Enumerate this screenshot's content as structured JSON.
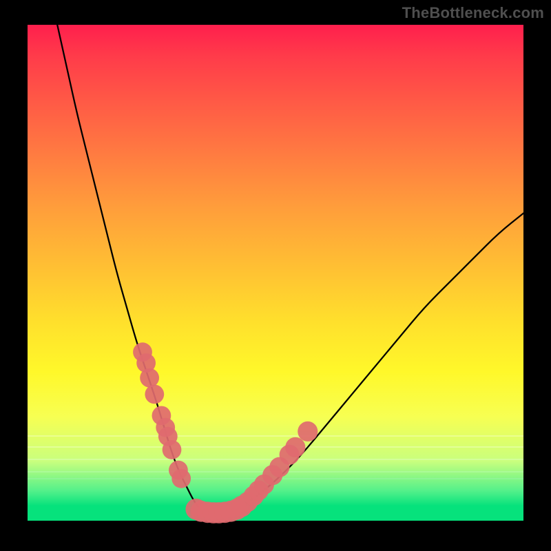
{
  "watermark": "TheBottleneck.com",
  "colors": {
    "frame_bg": "#000000",
    "curve_stroke": "#000000",
    "blob_fill": "#e06a6f",
    "blob_stroke": "#e06a6f"
  },
  "chart_data": {
    "type": "line",
    "title": "",
    "xlabel": "",
    "ylabel": "",
    "xlim": [
      0,
      100
    ],
    "ylim": [
      0,
      100
    ],
    "series": [
      {
        "name": "curve",
        "x": [
          6,
          8,
          10,
          12,
          14,
          16,
          18,
          20,
          22,
          24,
          26,
          27.5,
          29,
          30.5,
          32,
          33.5,
          35,
          41,
          45,
          50,
          55,
          60,
          65,
          70,
          75,
          80,
          85,
          90,
          95,
          100
        ],
        "values": [
          100,
          91,
          82,
          74,
          66,
          58,
          50,
          43,
          36,
          30,
          24,
          19,
          14,
          10,
          7,
          4,
          2,
          2,
          4,
          8,
          13,
          19,
          25,
          31,
          37,
          43,
          48,
          53,
          58,
          62
        ]
      }
    ],
    "markers": [
      {
        "x": 23.2,
        "y": 34.0,
        "r": 1.1
      },
      {
        "x": 23.9,
        "y": 31.8,
        "r": 1.1
      },
      {
        "x": 24.6,
        "y": 28.8,
        "r": 1.1
      },
      {
        "x": 25.6,
        "y": 25.5,
        "r": 1.1
      },
      {
        "x": 27.0,
        "y": 21.2,
        "r": 1.1
      },
      {
        "x": 27.8,
        "y": 18.8,
        "r": 1.1
      },
      {
        "x": 28.3,
        "y": 17.0,
        "r": 1.1
      },
      {
        "x": 29.1,
        "y": 14.3,
        "r": 1.1
      },
      {
        "x": 30.4,
        "y": 10.2,
        "r": 1.1
      },
      {
        "x": 31.0,
        "y": 8.5,
        "r": 1.1
      },
      {
        "x": 34.0,
        "y": 2.3,
        "r": 1.3
      },
      {
        "x": 35.0,
        "y": 1.9,
        "r": 1.3
      },
      {
        "x": 36.3,
        "y": 1.7,
        "r": 1.3
      },
      {
        "x": 37.5,
        "y": 1.6,
        "r": 1.3
      },
      {
        "x": 38.6,
        "y": 1.6,
        "r": 1.3
      },
      {
        "x": 39.8,
        "y": 1.7,
        "r": 1.3
      },
      {
        "x": 41.0,
        "y": 1.9,
        "r": 1.3
      },
      {
        "x": 42.2,
        "y": 2.3,
        "r": 1.3
      },
      {
        "x": 43.2,
        "y": 2.9,
        "r": 1.3
      },
      {
        "x": 44.4,
        "y": 3.8,
        "r": 1.2
      },
      {
        "x": 45.6,
        "y": 5.0,
        "r": 1.2
      },
      {
        "x": 46.6,
        "y": 6.1,
        "r": 1.2
      },
      {
        "x": 47.7,
        "y": 7.3,
        "r": 1.2
      },
      {
        "x": 49.4,
        "y": 9.2,
        "r": 1.2
      },
      {
        "x": 50.8,
        "y": 10.8,
        "r": 1.2
      },
      {
        "x": 52.8,
        "y": 13.3,
        "r": 1.2
      },
      {
        "x": 54.0,
        "y": 14.8,
        "r": 1.2
      },
      {
        "x": 56.5,
        "y": 18.0,
        "r": 1.2
      }
    ]
  }
}
